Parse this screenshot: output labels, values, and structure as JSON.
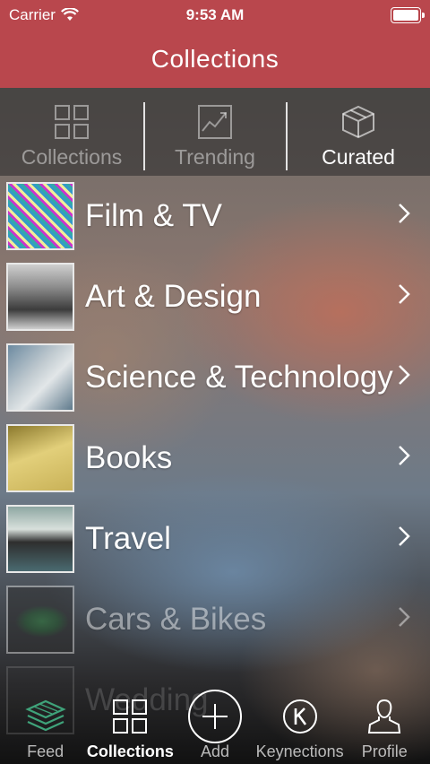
{
  "status_bar": {
    "carrier": "Carrier",
    "time": "9:53 AM"
  },
  "nav": {
    "title": "Collections"
  },
  "segments": [
    {
      "label": "Collections",
      "icon": "grid-icon",
      "active": false
    },
    {
      "label": "Trending",
      "icon": "trending-chart-icon",
      "active": false
    },
    {
      "label": "Curated",
      "icon": "cube-icon",
      "active": true
    }
  ],
  "collections": [
    {
      "label": "Film & TV"
    },
    {
      "label": "Art & Design"
    },
    {
      "label": "Science & Technology"
    },
    {
      "label": "Books"
    },
    {
      "label": "Travel"
    },
    {
      "label": "Cars & Bikes"
    },
    {
      "label": "Wedding"
    }
  ],
  "tabbar": [
    {
      "label": "Feed",
      "icon": "layers-icon",
      "active": false
    },
    {
      "label": "Collections",
      "icon": "grid-icon",
      "active": true
    },
    {
      "label": "Add",
      "icon": "add-circle-icon",
      "active": false
    },
    {
      "label": "Keynections",
      "icon": "keynections-k-icon",
      "active": false
    },
    {
      "label": "Profile",
      "icon": "person-icon",
      "active": false
    }
  ],
  "colors": {
    "header": "#b9474d",
    "feed_icon": "#3fa37a"
  }
}
